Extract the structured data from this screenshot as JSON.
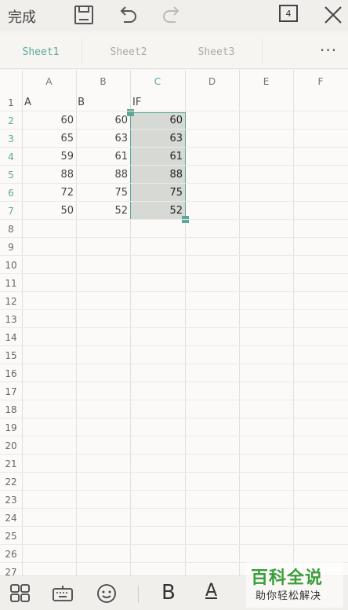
{
  "toolbar": {
    "done_label": "完成",
    "page_count": "4",
    "icons": [
      "save-icon",
      "undo-icon",
      "redo-icon",
      "close-icon"
    ]
  },
  "tabs": [
    {
      "label": "Sheet1",
      "active": true
    },
    {
      "label": "Sheet2",
      "active": false
    },
    {
      "label": "Sheet3",
      "active": false
    }
  ],
  "more_label": "···",
  "columns": [
    "A",
    "B",
    "C",
    "D",
    "E",
    "F"
  ],
  "selected_column": "C",
  "rows": [
    "1",
    "2",
    "3",
    "4",
    "5",
    "6",
    "7",
    "8",
    "9",
    "10",
    "11",
    "12",
    "13",
    "14",
    "15",
    "16",
    "17",
    "18",
    "19",
    "20",
    "21",
    "22",
    "23",
    "24",
    "25",
    "26",
    "27"
  ],
  "header_row": {
    "A": "A",
    "B": "B",
    "C": "IF"
  },
  "data_rows": [
    {
      "A": "60",
      "B": "60",
      "C": "60"
    },
    {
      "A": "65",
      "B": "63",
      "C": "63"
    },
    {
      "A": "59",
      "B": "61",
      "C": "61"
    },
    {
      "A": "88",
      "B": "88",
      "C": "88"
    },
    {
      "A": "72",
      "B": "75",
      "C": "75"
    },
    {
      "A": "50",
      "B": "52",
      "C": "52"
    }
  ],
  "bottom_toolbar": {
    "bold_label": "B",
    "font_color_label": "A",
    "icons": [
      "grid-icon",
      "keyboard-icon",
      "emoji-icon"
    ]
  },
  "watermark": {
    "main": "百科全说",
    "sub": "助你轻松解决"
  },
  "colors": {
    "accent": "#5aa898",
    "watermark_green": "#3a9e3a"
  }
}
